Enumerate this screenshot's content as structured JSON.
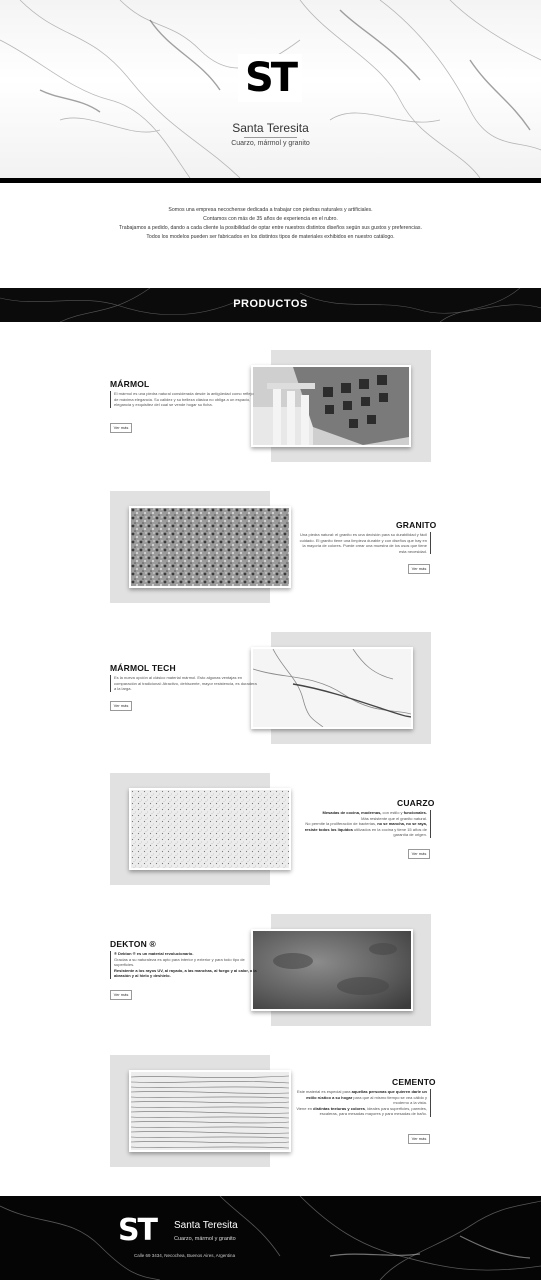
{
  "brand": {
    "logo": "ST",
    "name": "Santa Teresita",
    "tagline": "Cuarzo, mármol y granito"
  },
  "intro": {
    "lines": [
      "Somos una empresa necochense dedicada a trabajar con piedras naturales y artificiales.",
      "Contamos con más de 35 años de experiencia en el rubro.",
      "Trabajamos a pedido, dando a cada cliente la posibilidad de optar entre nuestros distintos diseños según sus gustos y preferencias.",
      "Todos los modelos pueden ser fabricados en los distintos tipos de materiales exhibidos en nuestro catálogo."
    ]
  },
  "section": {
    "title": "PRODUCTOS"
  },
  "products": [
    {
      "title": "MÁRMOL",
      "body": "El mármol es una piedra natural considerada desde la antigüedad como reflejo de máxima elegancia. Su calidez y su belleza clásica no obliga a un espacio, elegancia y exquisitez del cual se vende hogar su ficha.",
      "button": "Ver más"
    },
    {
      "title": "GRANITO",
      "body": "Una piedra natural: el granito es una decisión para su durabilidad y fácil cuidado. El granito tiene una limpieza durable y con diseños que hay en la mayoría de colores. Puede crear una muestra de los usos que tiene esta necesidad.",
      "button": "Ver más"
    },
    {
      "title": "MÁRMOL TECH",
      "body": "Es la nueva opción al clásico material mármol. Esto algunas ventajas en comparación al tradicional: Atractivo, dehiscente, mayor resistencia, es duradera a la larga.",
      "button": "Ver más"
    },
    {
      "title": "CUARZO",
      "body_html": "<b>Mesadas de cocina, modernas,</b> con estilo y <b>funcionales.</b><br>Más resistente que el granito natural.<br>No permite la proliferación de bacterias, <b>no se mancha, no se raya, resiste todos los líquidos</b> utilizados en la cocina y tiene 15 años de garantía de origen.",
      "button": "Ver más"
    },
    {
      "title": "DEKTON ®",
      "body_html": "<b>® Dekton ® es un material revolucionario.</b><br>Gracias a su naturaleza es apto para interior y exterior y para todo tipo de superficies.<br><b>Resistente a los rayos UV, al rayado, a las manchas, al fuego y al calor, a la abrasión y al hielo y deshielo.</b>",
      "button": "Ver más"
    },
    {
      "title": "CEMENTO",
      "body_html": "Este material es especial para <b>aquellas personas que quieren darle un estilo rústico a su hogar</b> para que al mismo tiempo se vea cálido y moderno a la vista.<br>Viene en <b>distintas texturas y colores</b>, ideales para superficies, paredes, escaleras, para mesadas mayores y para mesadas de baño.",
      "button": "Ver más"
    }
  ],
  "footer": {
    "logo": "ST",
    "name": "Santa Teresita",
    "tagline": "Cuarzo, mármol y granito",
    "address": "Calle 69 3434, Necochea, Buenos Aires, Argentina"
  }
}
